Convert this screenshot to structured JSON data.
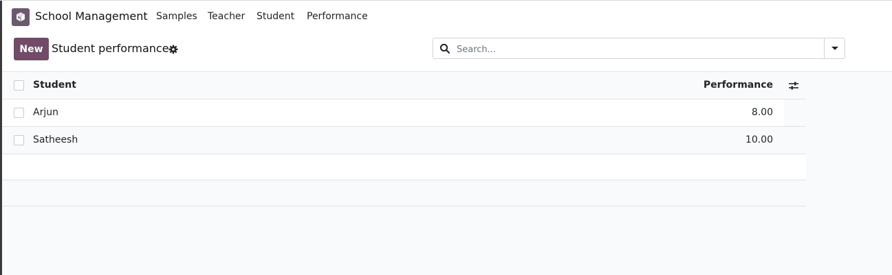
{
  "app": {
    "title": "School Management",
    "brand_color": "#714b67"
  },
  "menu": [
    {
      "label": "Samples"
    },
    {
      "label": "Teacher"
    },
    {
      "label": "Student"
    },
    {
      "label": "Performance"
    }
  ],
  "control_panel": {
    "new_button": "New",
    "title": "Student performance",
    "settings_icon": "gear-icon",
    "search": {
      "placeholder": "Search...",
      "value": ""
    }
  },
  "table": {
    "columns": [
      "Student",
      "Performance"
    ],
    "rows": [
      {
        "student": "Arjun",
        "performance": "8.00"
      },
      {
        "student": "Satheesh",
        "performance": "10.00"
      }
    ],
    "optional_columns_icon": "sliders-icon"
  }
}
